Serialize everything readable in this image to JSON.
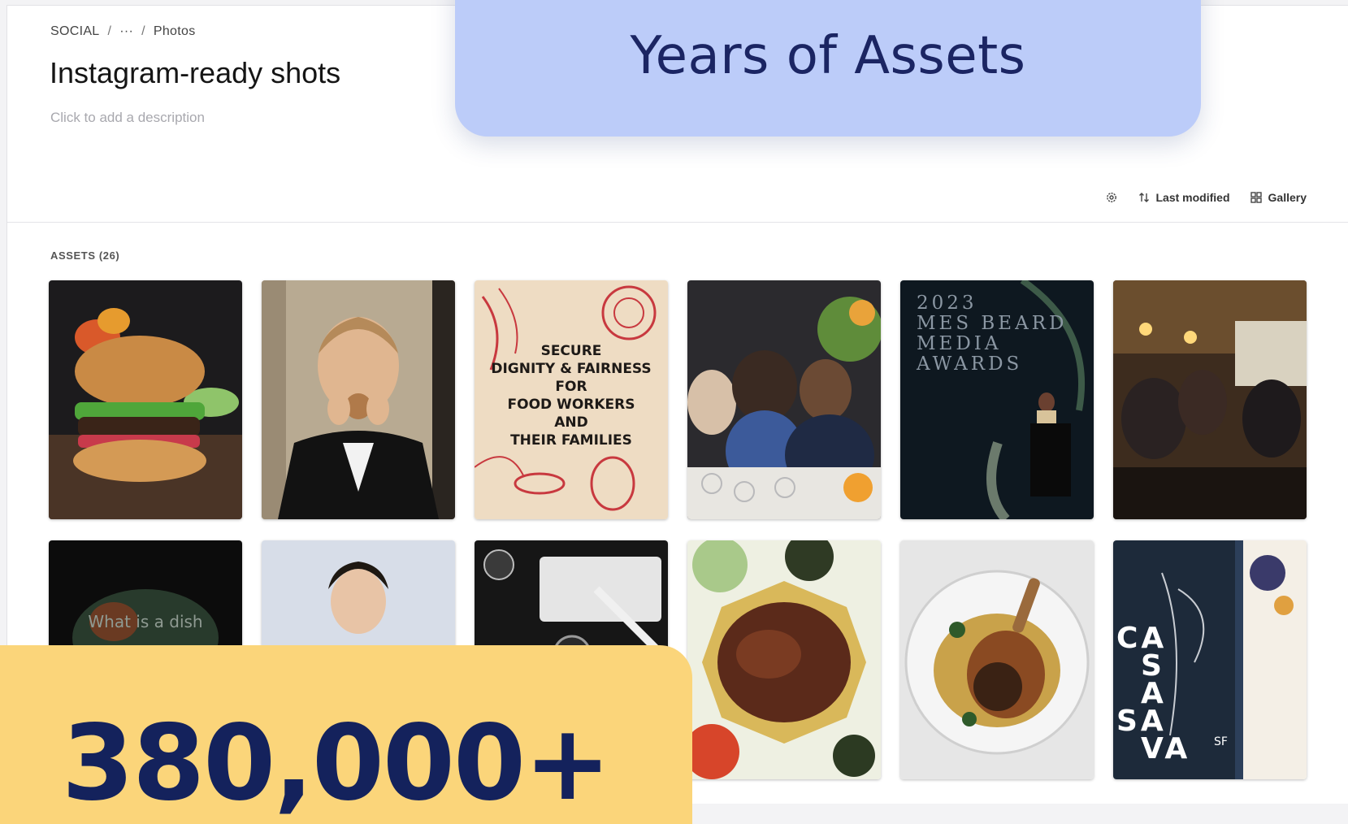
{
  "breadcrumb": {
    "root": "SOCIAL",
    "sep": "/",
    "ellipsis": "···",
    "current": "Photos"
  },
  "page": {
    "title": "Instagram-ready shots",
    "description_placeholder": "Click to add a description"
  },
  "toolbar": {
    "settings_icon": "gear-icon",
    "sort_label": "Last modified",
    "sort_icon": "sort-arrows-icon",
    "view_label": "Gallery",
    "view_icon": "grid-icon"
  },
  "assets": {
    "label": "ASSETS (26)",
    "tiles": [
      {
        "subject": "burger"
      },
      {
        "subject": "man-with-medal"
      },
      {
        "subject": "poster",
        "lines": [
          "SECURE",
          "DIGNITY & FAIRNESS",
          "FOR",
          "FOOD WORKERS",
          "AND",
          "THEIR FAMILIES"
        ]
      },
      {
        "subject": "dinner-table"
      },
      {
        "subject": "awards-stage",
        "lines": [
          "2023",
          "MES BEARD",
          "MEDIA",
          "AWARDS"
        ]
      },
      {
        "subject": "bar-cheers"
      },
      {
        "subject": "dark-dish",
        "lines": [
          "What is a dish"
        ]
      },
      {
        "subject": "portrait"
      },
      {
        "subject": "camera-bw"
      },
      {
        "subject": "food-platter"
      },
      {
        "subject": "roasted-duck"
      },
      {
        "subject": "casava-sign",
        "lines": [
          "CA",
          "S",
          "A",
          "SA",
          "VA",
          "SF"
        ]
      }
    ]
  },
  "overlays": {
    "headline": "Years of Assets",
    "stat": "380,000+"
  },
  "colors": {
    "overlay_blue": "#bcccf9",
    "overlay_yellow": "#fbd57a",
    "headline_text": "#1b2563"
  }
}
